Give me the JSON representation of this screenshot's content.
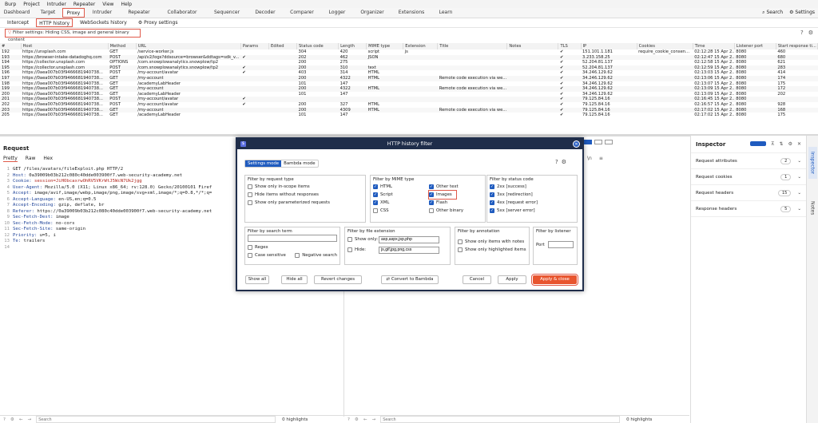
{
  "menu": [
    "Burp",
    "Project",
    "Intruder",
    "Repeater",
    "View",
    "Help"
  ],
  "tabs": [
    "Dashboard",
    "Target",
    "Proxy",
    "Intruder",
    "Repeater",
    "Collaborator",
    "Sequencer",
    "Decoder",
    "Comparer",
    "Logger",
    "Organizer",
    "Extensions",
    "Learn"
  ],
  "tab_right": {
    "search": "Search",
    "settings": "Settings"
  },
  "subtabs": [
    "Intercept",
    "HTTP history",
    "WebSockets history",
    "Proxy settings"
  ],
  "filter_text": "Filter settings: Hiding CSS, image and general binary content",
  "columns": [
    "#",
    "Host",
    "Method",
    "URL",
    "Params",
    "Edited",
    "Status code",
    "Length",
    "MIME type",
    "Extension",
    "Title",
    "Notes",
    "TLS",
    "IP",
    "Cookies",
    "Time",
    "Listener port",
    "Start response ti..."
  ],
  "rows": [
    [
      "192",
      "https://unsplash.com",
      "GET",
      "/service-worker.js",
      "",
      "",
      "304",
      "420",
      "script",
      "js",
      "",
      "",
      "✔",
      "151.101.1.181",
      "require_cookie_consen...",
      "02:12:28 15 Apr 2...",
      "8080",
      "460"
    ],
    [
      "193",
      "https://browser-intake-datadoghq.com",
      "POST",
      "/api/v2/logs?ddsource=browser&ddtags=sdk_v...",
      "✔",
      "",
      "202",
      "462",
      "JSON",
      "",
      "",
      "",
      "✔",
      "3.233.158.25",
      "",
      "02:12:47 15 Apr 2...",
      "8080",
      "680"
    ],
    [
      "194",
      "https://collector.unsplash.com",
      "OPTIONS",
      "/com.snowplowanalytics.snowplow/tp2",
      "",
      "",
      "200",
      "275",
      "",
      "",
      "",
      "",
      "✔",
      "52.204.81.137",
      "",
      "02:12:58 15 Apr 2...",
      "8080",
      "621"
    ],
    [
      "195",
      "https://collector.unsplash.com",
      "POST",
      "/com.snowplowanalytics.snowplow/tp2",
      "✔",
      "",
      "200",
      "310",
      "text",
      "",
      "",
      "",
      "✔",
      "52.204.81.137",
      "",
      "02:12:59 15 Apr 2...",
      "8080",
      "283"
    ],
    [
      "196",
      "https://0aea007b03f9466681940738...",
      "POST",
      "/my-account/avatar",
      "✔",
      "",
      "403",
      "314",
      "HTML",
      "",
      "",
      "",
      "✔",
      "34.246.129.62",
      "",
      "02:13:03 15 Apr 2...",
      "8080",
      "414"
    ],
    [
      "197",
      "https://0aea007b03f9466681940738...",
      "GET",
      "/my-account",
      "",
      "",
      "200",
      "4322",
      "HTML",
      "",
      "Remote code execution via we...",
      "",
      "✔",
      "34.246.129.62",
      "",
      "02:13:06 15 Apr 2...",
      "8080",
      "174"
    ],
    [
      "198",
      "https://0aea007b03f9466681940738...",
      "GET",
      "/academyLabHeader",
      "",
      "",
      "101",
      "147",
      "",
      "",
      "",
      "",
      "✔",
      "34.246.129.62",
      "",
      "02:13:07 15 Apr 2...",
      "8080",
      "175"
    ],
    [
      "199",
      "https://0aea007b03f9466681940738...",
      "GET",
      "/my-account",
      "",
      "",
      "200",
      "4322",
      "HTML",
      "",
      "Remote code execution via we...",
      "",
      "✔",
      "34.246.129.62",
      "",
      "02:13:09 15 Apr 2...",
      "8080",
      "172"
    ],
    [
      "200",
      "https://0aea007b03f9466681940738...",
      "GET",
      "/academyLabHeader",
      "",
      "",
      "101",
      "147",
      "",
      "",
      "",
      "",
      "✔",
      "34.246.129.62",
      "",
      "02:13:09 15 Apr 2...",
      "8080",
      "202"
    ],
    [
      "201",
      "https://0aea007b03f9466681940738...",
      "POST",
      "/my-account/avatar",
      "✔",
      "",
      "",
      "",
      "",
      "",
      "",
      "",
      "✔",
      "79.125.84.16",
      "",
      "02:16:45 15 Apr 2...",
      "8080",
      ""
    ],
    [
      "202",
      "https://0aea007b03f9466681940738...",
      "POST",
      "/my-account/avatar",
      "✔",
      "",
      "200",
      "327",
      "HTML",
      "",
      "",
      "",
      "✔",
      "79.125.84.16",
      "",
      "02:16:57 15 Apr 2...",
      "8080",
      "928"
    ],
    [
      "203",
      "https://0aea007b03f9466681940738...",
      "GET",
      "/my-account",
      "",
      "",
      "200",
      "4309",
      "HTML",
      "",
      "Remote code execution via we...",
      "",
      "✔",
      "79.125.84.16",
      "",
      "02:17:02 15 Apr 2...",
      "8080",
      "168"
    ],
    [
      "205",
      "https://0aea007b03f9466681940738...",
      "GET",
      "/academyLabHeader",
      "",
      "",
      "101",
      "147",
      "",
      "",
      "",
      "",
      "✔",
      "79.125.84.16",
      "",
      "02:17:02 15 Apr 2...",
      "8080",
      "175"
    ]
  ],
  "request": {
    "title": "Request",
    "tabs": [
      "Pretty",
      "Raw",
      "Hex"
    ],
    "lines": [
      {
        "n": "1",
        "k": "",
        "v": "",
        "t": "GET /files/avatars/fileExploit.php HTTP/2"
      },
      {
        "n": "2",
        "k": "Host:",
        "v": "",
        "t": " 0a39009b03b212c080c40dde003900f7.web-security-academy.net"
      },
      {
        "n": "3",
        "k": "Cookie:",
        "v": " session=JiHObcaxrwOhRV5VKrWtJ5WcN7Uk2jgg",
        "t": ""
      },
      {
        "n": "4",
        "k": "User-Agent:",
        "v": "",
        "t": " Mozilla/5.0 (X11; Linux x86_64; rv:128.0) Gecko/20100101 Firef"
      },
      {
        "n": "5",
        "k": "Accept:",
        "v": "",
        "t": " image/avif,image/webp,image/png,image/svg+xml,image/*;q=0.8,*/*;q="
      },
      {
        "n": "6",
        "k": "Accept-Language:",
        "v": "",
        "t": " en-US,en;q=0.5"
      },
      {
        "n": "7",
        "k": "Accept-Encoding:",
        "v": "",
        "t": " gzip, deflate, br"
      },
      {
        "n": "8",
        "k": "Referer:",
        "v": "",
        "t": " https://0a39009b03b212c080c40dde003900f7.web-security-academy.net"
      },
      {
        "n": "9",
        "k": "Sec-Fetch-Dest:",
        "v": "",
        "t": " image"
      },
      {
        "n": "10",
        "k": "Sec-Fetch-Mode:",
        "v": "",
        "t": " no-cors"
      },
      {
        "n": "11",
        "k": "Sec-Fetch-Site:",
        "v": "",
        "t": " same-origin"
      },
      {
        "n": "12",
        "k": "Priority:",
        "v": "",
        "t": " u=5, i"
      },
      {
        "n": "13",
        "k": "Te:",
        "v": "",
        "t": " trailers"
      },
      {
        "n": "14",
        "k": "",
        "v": "",
        "t": ""
      }
    ]
  },
  "search": {
    "placeholder": "Search",
    "highlights": "0 highlights"
  },
  "inspector": {
    "title": "Inspector",
    "rows": [
      {
        "label": "Request attributes",
        "count": "2"
      },
      {
        "label": "Request cookies",
        "count": "1"
      },
      {
        "label": "Request headers",
        "count": "15"
      },
      {
        "label": "Response headers",
        "count": "5"
      }
    ]
  },
  "side_tabs": [
    "Inspector",
    "Notes"
  ],
  "dialog": {
    "title": "HTTP history filter",
    "mode_tabs": [
      "Settings mode",
      "Bambda mode"
    ],
    "by_request": {
      "title": "Filter by request type",
      "items": [
        {
          "label": "Show only in-scope items",
          "on": false
        },
        {
          "label": "Hide items without responses",
          "on": false
        },
        {
          "label": "Show only parameterized requests",
          "on": false
        }
      ]
    },
    "by_mime": {
      "title": "Filter by MIME type",
      "items": [
        {
          "label": "HTML",
          "on": true
        },
        {
          "label": "Other text",
          "on": true
        },
        {
          "label": "Script",
          "on": true
        },
        {
          "label": "Images",
          "on": true
        },
        {
          "label": "XML",
          "on": true
        },
        {
          "label": "Flash",
          "on": true
        },
        {
          "label": "CSS",
          "on": false
        },
        {
          "label": "Other binary",
          "on": false
        }
      ]
    },
    "by_status": {
      "title": "Filter by status code",
      "items": [
        {
          "label": "2xx  [success]",
          "on": true
        },
        {
          "label": "3xx  [redirection]",
          "on": true
        },
        {
          "label": "4xx  [request error]",
          "on": true
        },
        {
          "label": "5xx  [server error]",
          "on": true
        }
      ]
    },
    "by_search": {
      "title": "Filter by search term",
      "items": [
        {
          "label": "Regex",
          "on": false
        },
        {
          "label": "Case sensitive",
          "on": false
        },
        {
          "label": "Negative search",
          "on": false
        }
      ]
    },
    "by_ext": {
      "title": "Filter by file extension",
      "show_only": "Show only:",
      "show_val": "asp,aspx,jsp,php",
      "hide": "Hide:",
      "hide_val": "js,gif,jpg,png,css"
    },
    "by_annot": {
      "title": "Filter by annotation",
      "items": [
        {
          "label": "Show only items with notes",
          "on": false
        },
        {
          "label": "Show only highlighted items",
          "on": false
        }
      ]
    },
    "by_listener": {
      "title": "Filter by listener",
      "port": "Port"
    },
    "buttons": {
      "show_all": "Show all",
      "hide_all": "Hide all",
      "revert": "Revert changes",
      "convert": "Convert to Bambda",
      "cancel": "Cancel",
      "apply": "Apply",
      "apply_close": "Apply & close"
    }
  }
}
